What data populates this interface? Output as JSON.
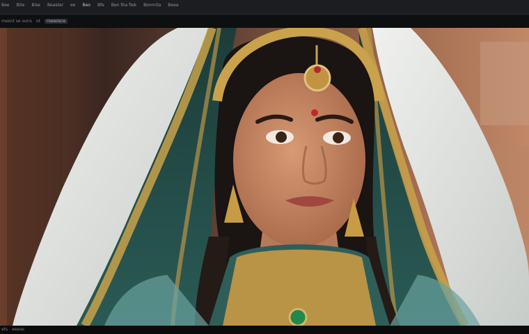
{
  "menu": {
    "items": [
      "Bee",
      "Bite",
      "Bise",
      "Beaster",
      "ee",
      "Beo",
      "Bfe",
      "Ben tha fiek",
      "Bonnnta",
      "Beea"
    ],
    "active_index": 5
  },
  "subbar": {
    "crumbs": [
      "mesnt se ouns",
      "ot",
      "roeeosce"
    ]
  },
  "image": {
    "alt": "Portrait of a woman in traditional jewelry and veil"
  },
  "status": {
    "items": [
      "ets",
      "eeeas"
    ]
  },
  "colors": {
    "topbar": "#1b1d20",
    "background": "#0b0b0c",
    "veil_white": "#e7e9e5",
    "teal_silk": "#1f4a45",
    "gold": "#c9a24a",
    "skin": "#c48a66",
    "wall": "#b57b5c"
  }
}
